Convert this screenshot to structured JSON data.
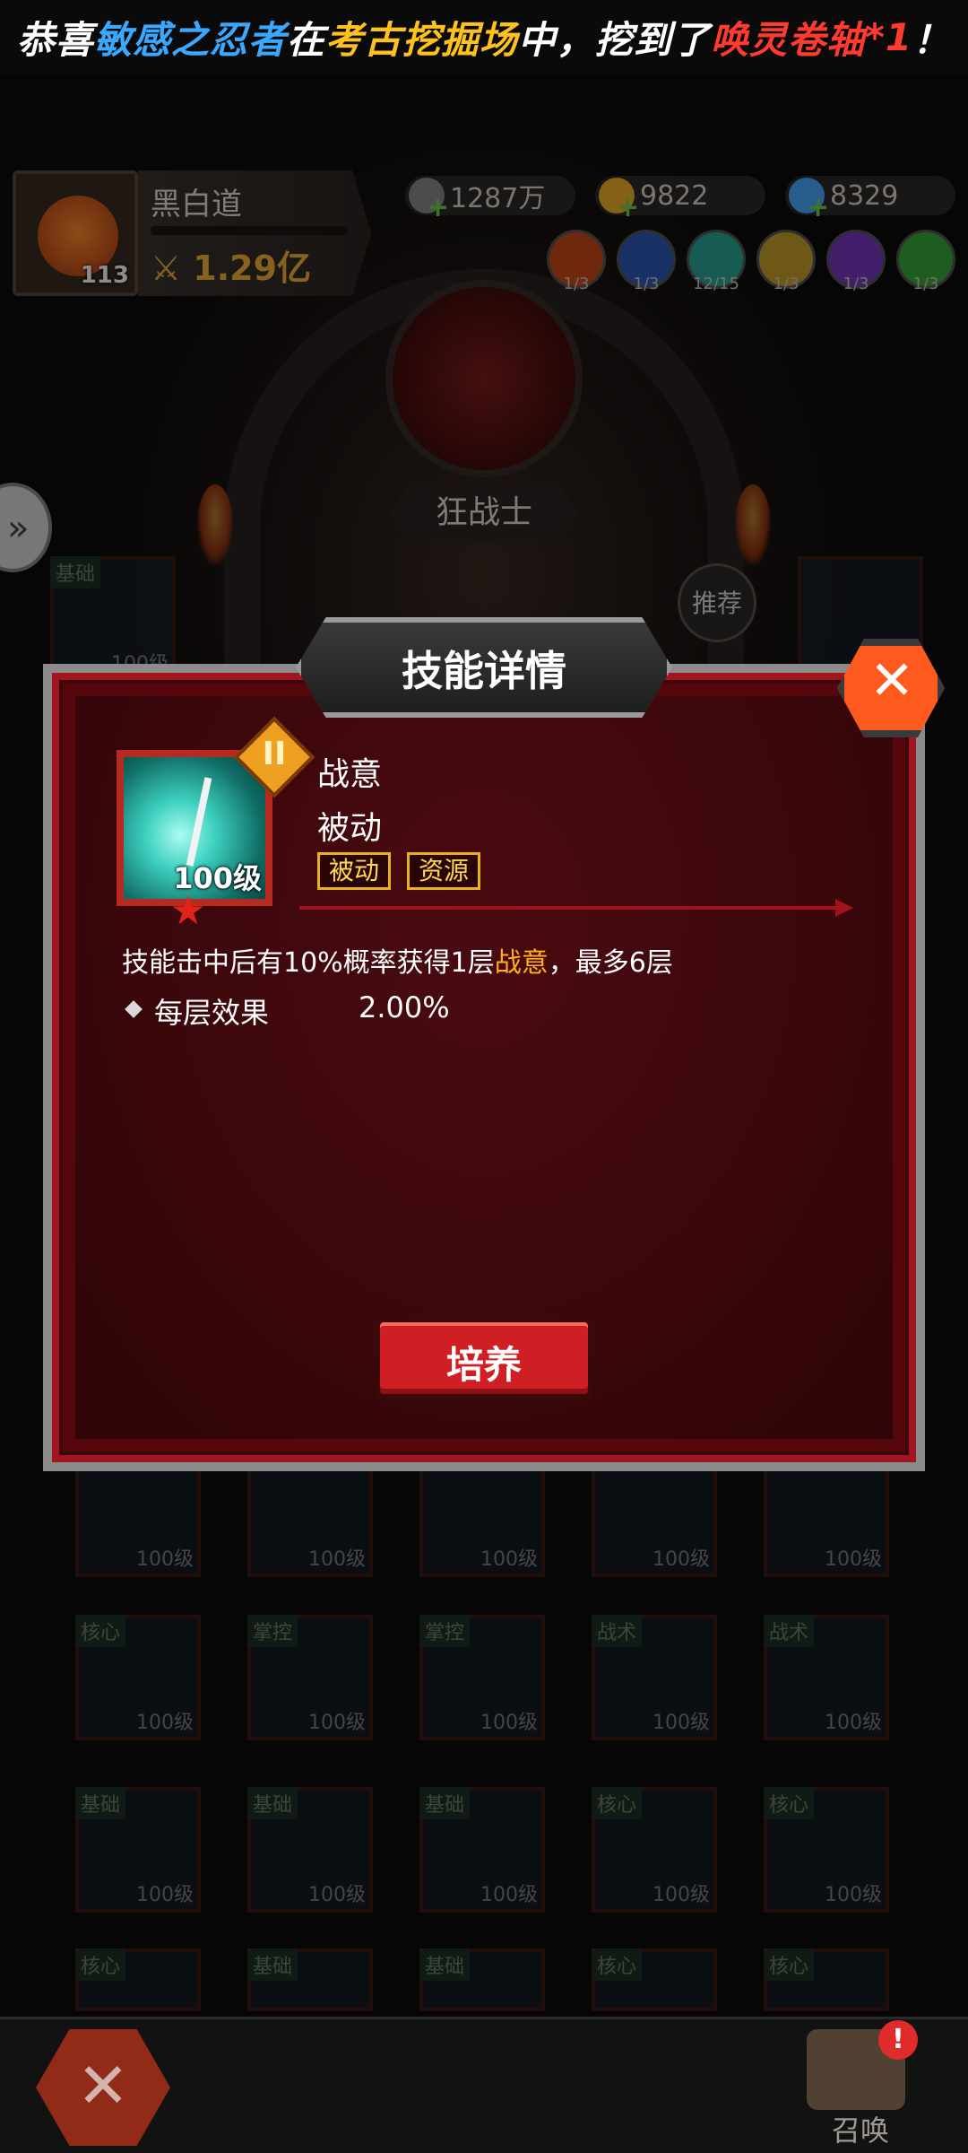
{
  "announcement": {
    "prefix": "恭喜",
    "player": "敏感之忍者",
    "at": "在",
    "place": "考古挖掘场",
    "middle": "中，挖到了",
    "item": "唤灵卷轴",
    "qty": "*1",
    "suffix": "！"
  },
  "player": {
    "name": "黑白道",
    "level": "113",
    "power": "1.29亿"
  },
  "resources": [
    {
      "value": "1287万",
      "color": "#8a8a8a"
    },
    {
      "value": "9822",
      "color": "#f2b02a"
    },
    {
      "value": "8329",
      "color": "#4aa8ff"
    }
  ],
  "elements": [
    {
      "name": "fire-element-icon",
      "count": "1/3",
      "color": "#c94a1a"
    },
    {
      "name": "wind-element-icon",
      "count": "1/3",
      "color": "#2e5ab8"
    },
    {
      "name": "ice-element-icon",
      "count": "12/15",
      "color": "#2aa89a"
    },
    {
      "name": "light-element-icon",
      "count": "1/3",
      "color": "#c7a02a"
    },
    {
      "name": "dark-element-icon",
      "count": "1/3",
      "color": "#7a3ac4"
    },
    {
      "name": "nature-element-icon",
      "count": "1/3",
      "color": "#3aa83a"
    }
  ],
  "class_name": "狂战士",
  "recommend_label": "推荐",
  "dialog": {
    "title": "技能详情",
    "close_label": "✕",
    "skill": {
      "name": "战意",
      "type": "被动",
      "level": "100级",
      "rank": "II",
      "tags": [
        "被动",
        "资源"
      ],
      "description_pre": "技能击中后有10%概率获得1层",
      "description_highlight": "战意",
      "description_post": "，最多6层",
      "effect_label": "每层效果",
      "effect_value": "2.00%"
    },
    "train_label": "培养"
  },
  "grid": {
    "tile_level": "100级",
    "tags": [
      "基础",
      "核心",
      "掌控",
      "战术"
    ]
  },
  "bottom": {
    "close_label": "✕",
    "summon_label": "召唤",
    "alert": "!"
  },
  "colors": {
    "dialog_bg": "#55070d",
    "accent_red": "#cf1f24",
    "highlight": "#ffb01a",
    "tag_border": "#e8b21d"
  }
}
